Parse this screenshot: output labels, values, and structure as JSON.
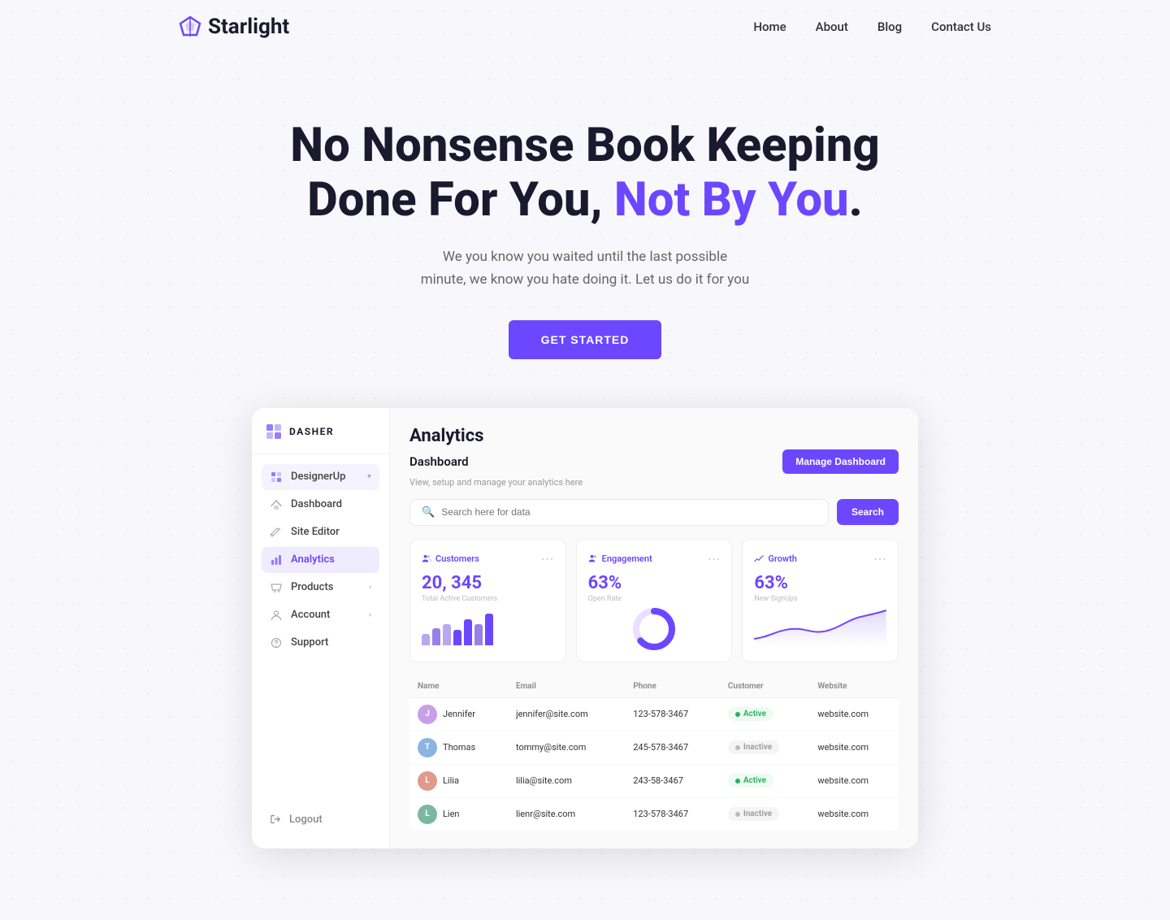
{
  "nav": {
    "logo": "Starlight",
    "links": [
      "Home",
      "About",
      "Blog",
      "Contact Us"
    ]
  },
  "hero": {
    "line1": "No Nonsense Book Keeping",
    "line2_prefix": "Done For You, ",
    "line2_accent": "Not By You",
    "line2_suffix": ".",
    "description_line1": "We you know you waited until the last possible",
    "description_line2": "minute, we know you hate doing it. Let us do it for you",
    "cta": "GET STARTED"
  },
  "sidebar": {
    "brand": "DASHER",
    "items": [
      {
        "label": "DesignerUp",
        "has_chevron": true,
        "expanded": true
      },
      {
        "label": "Dashboard"
      },
      {
        "label": "Site Editor"
      },
      {
        "label": "Analytics",
        "active": true
      },
      {
        "label": "Products",
        "has_chevron": true
      },
      {
        "label": "Account",
        "has_chevron": true
      },
      {
        "label": "Support"
      }
    ],
    "logout": "Logout"
  },
  "main": {
    "section_title": "Analytics",
    "dashboard_label": "Dashboard",
    "dashboard_sub": "View, setup and manage your analytics here",
    "manage_btn": "Manage Dashboard",
    "search_placeholder": "Search here for data",
    "search_btn": "Search",
    "metrics": [
      {
        "title": "Customers",
        "value": "20, 345",
        "sub": "Total Active Customers",
        "type": "bar",
        "bars": [
          30,
          45,
          55,
          40,
          60,
          50,
          70
        ]
      },
      {
        "title": "Engagement",
        "value": "63%",
        "sub": "Open Rate",
        "type": "donut",
        "percent": 63
      },
      {
        "title": "Growth",
        "value": "63%",
        "sub": "New SignUps",
        "type": "sparkline"
      }
    ],
    "table": {
      "columns": [
        "Name",
        "Email",
        "Phone",
        "Customer",
        "Website"
      ],
      "rows": [
        {
          "name": "Jennifer",
          "email": "jennifer@site.com",
          "phone": "123-578-3467",
          "status": "Active",
          "website": "website.com",
          "avatar_color": "#c9a0e8",
          "avatar_initials": "J"
        },
        {
          "name": "Thomas",
          "email": "tommy@site.com",
          "phone": "245-578-3467",
          "status": "Inactive",
          "website": "website.com",
          "avatar_color": "#8bb4e0",
          "avatar_initials": "T"
        },
        {
          "name": "Lilia",
          "email": "lilia@site.com",
          "phone": "243-58-3467",
          "status": "Active",
          "website": "website.com",
          "avatar_color": "#e09a8b",
          "avatar_initials": "L"
        },
        {
          "name": "Lien",
          "email": "lienr@site.com",
          "phone": "123-578-3467",
          "status": "Inactive",
          "website": "website.com",
          "avatar_color": "#7bb8a0",
          "avatar_initials": "L"
        }
      ]
    }
  },
  "colors": {
    "accent": "#6c47ff",
    "active_green": "#27ae60",
    "inactive_gray": "#999"
  }
}
